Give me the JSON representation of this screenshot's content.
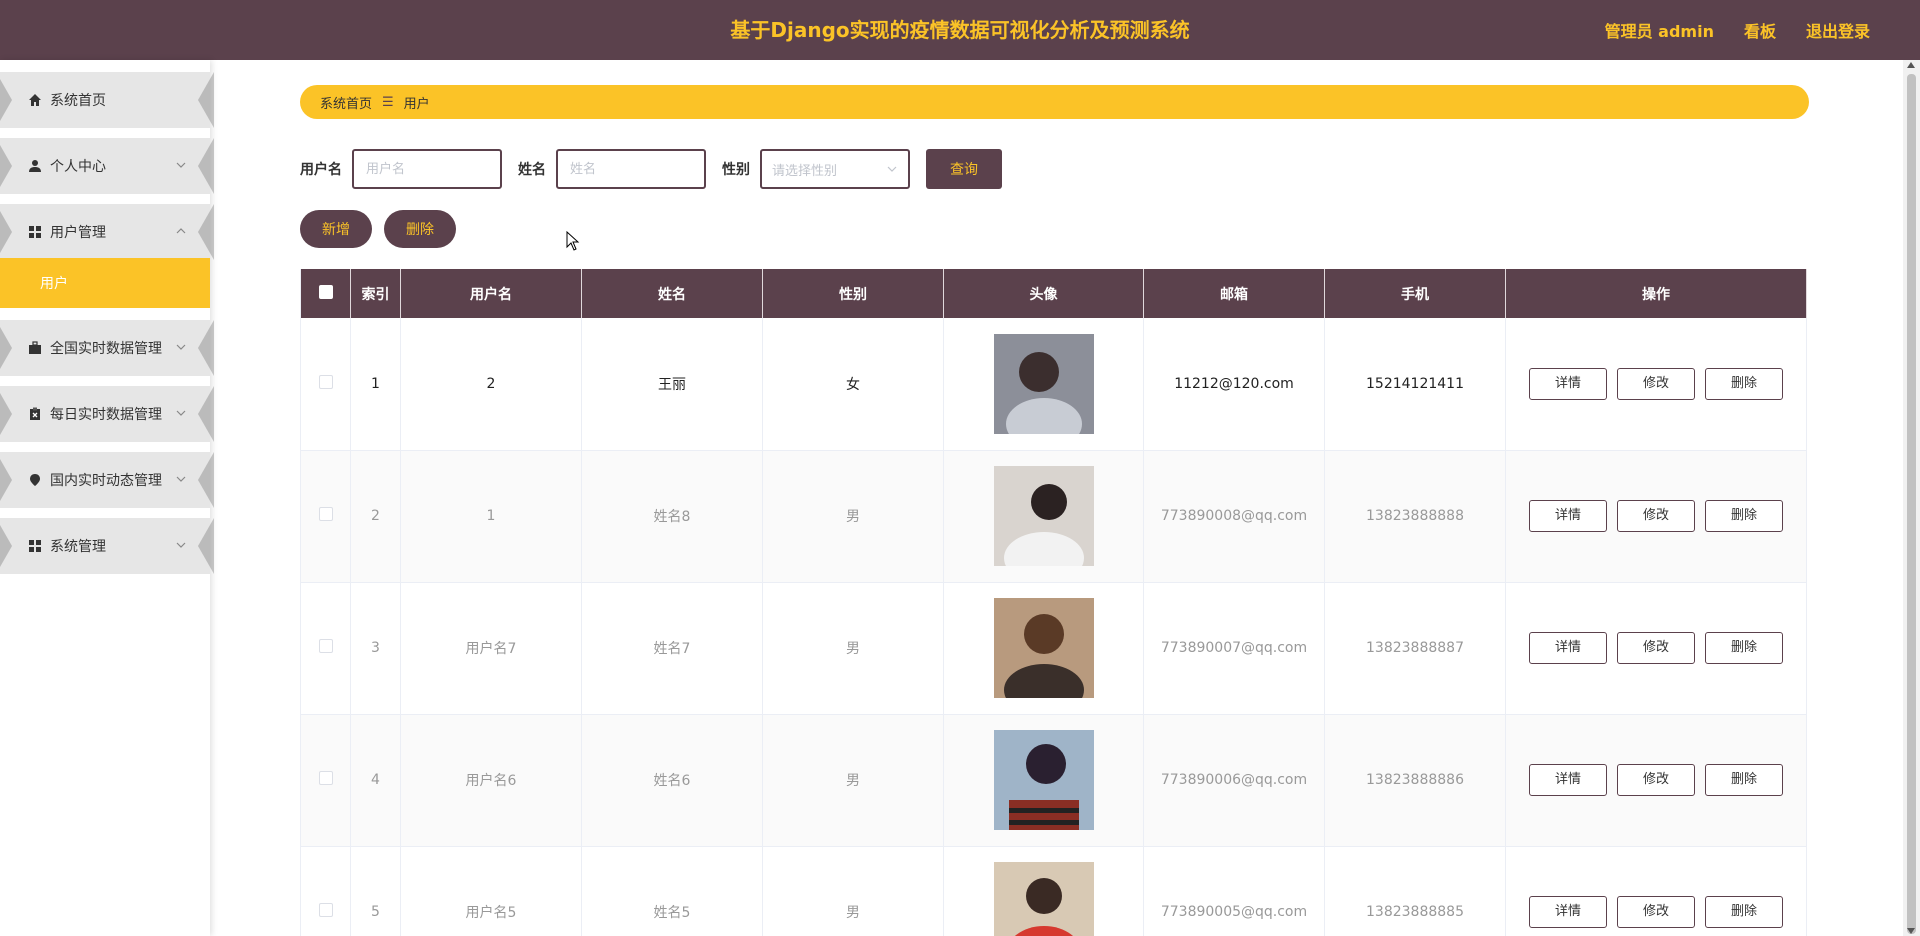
{
  "header": {
    "title": "基于Django实现的疫情数据可视化分析及预测系统",
    "user_label": "管理员 admin",
    "board_label": "看板",
    "logout_label": "退出登录"
  },
  "sidebar": {
    "items": [
      {
        "label": "系统首页",
        "icon": "home-icon"
      },
      {
        "label": "个人中心",
        "icon": "user-icon"
      },
      {
        "label": "用户管理",
        "icon": "grid-icon"
      },
      {
        "label": "全国实时数据管理",
        "icon": "briefcase-icon"
      },
      {
        "label": "每日实时数据管理",
        "icon": "clipboard-x-icon"
      },
      {
        "label": "国内实时动态管理",
        "icon": "location-pin-icon"
      },
      {
        "label": "系统管理",
        "icon": "grid-icon"
      }
    ],
    "submenu": {
      "label": "用户"
    }
  },
  "breadcrumb": {
    "home": "系统首页",
    "separator": "☰",
    "current": "用户"
  },
  "search": {
    "username_label": "用户名",
    "username_placeholder": "用户名",
    "name_label": "姓名",
    "name_placeholder": "姓名",
    "gender_label": "性别",
    "gender_placeholder": "请选择性别",
    "query_button": "查询"
  },
  "actions": {
    "add_button": "新增",
    "delete_button": "删除"
  },
  "table": {
    "headers": [
      "索引",
      "用户名",
      "姓名",
      "性别",
      "头像",
      "邮箱",
      "手机",
      "操作"
    ],
    "row_actions": {
      "detail": "详情",
      "edit": "修改",
      "delete": "删除"
    },
    "rows": [
      {
        "index": "1",
        "username": "2",
        "name": "王丽",
        "gender": "女",
        "email": "11212@120.com",
        "phone": "15214121411"
      },
      {
        "index": "2",
        "username": "1",
        "name": "姓名8",
        "gender": "男",
        "email": "773890008@qq.com",
        "phone": "13823888888"
      },
      {
        "index": "3",
        "username": "用户名7",
        "name": "姓名7",
        "gender": "男",
        "email": "773890007@qq.com",
        "phone": "13823888887"
      },
      {
        "index": "4",
        "username": "用户名6",
        "name": "姓名6",
        "gender": "男",
        "email": "773890006@qq.com",
        "phone": "13823888886"
      },
      {
        "index": "5",
        "username": "用户名5",
        "name": "姓名5",
        "gender": "男",
        "email": "773890005@qq.com",
        "phone": "13823888885"
      }
    ]
  },
  "colors": {
    "primary": "#5b414c",
    "accent": "#fbc327"
  }
}
